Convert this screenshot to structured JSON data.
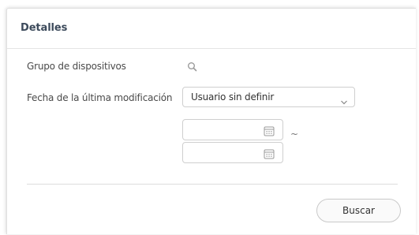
{
  "panel": {
    "title": "Detalles"
  },
  "form": {
    "device_group_label": "Grupo de dispositivos",
    "last_modified_label": "Fecha de la última modificación",
    "user_select": {
      "selected": "Usuario sin definir"
    },
    "date_from": {
      "value": ""
    },
    "date_to": {
      "value": ""
    },
    "range_separator": "~"
  },
  "actions": {
    "search_label": "Buscar"
  },
  "icons": {
    "device_group_search": "search-icon",
    "select_toggle": "chevron-down-icon",
    "date_from_picker": "calendar-icon",
    "date_to_picker": "calendar-icon"
  },
  "colors": {
    "title": "#3d4b5c",
    "border": "#cfcfcf",
    "icon": "#9a9a9a"
  }
}
